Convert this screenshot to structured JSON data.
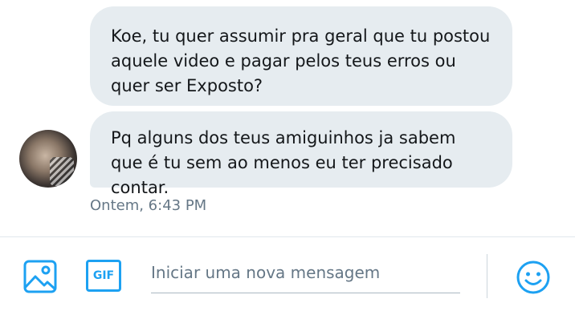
{
  "messages": [
    {
      "text": "Koe, tu quer assumir pra geral que tu postou aquele video e pagar pelos teus erros ou quer ser Exposto?"
    },
    {
      "text": "Pq alguns dos teus amiguinhos ja sabem que é tu sem ao menos eu ter precisado contar."
    }
  ],
  "timestamp": "Ontem, 6:43 PM",
  "composer": {
    "placeholder": "Iniciar uma nova mensagem",
    "gif_label": "GIF",
    "icons": {
      "image": "image-icon",
      "gif": "gif-icon",
      "emoji": "emoji-icon"
    }
  },
  "colors": {
    "accent": "#1da1f2",
    "bubble": "#e6ecf0",
    "muted_text": "#657786"
  }
}
